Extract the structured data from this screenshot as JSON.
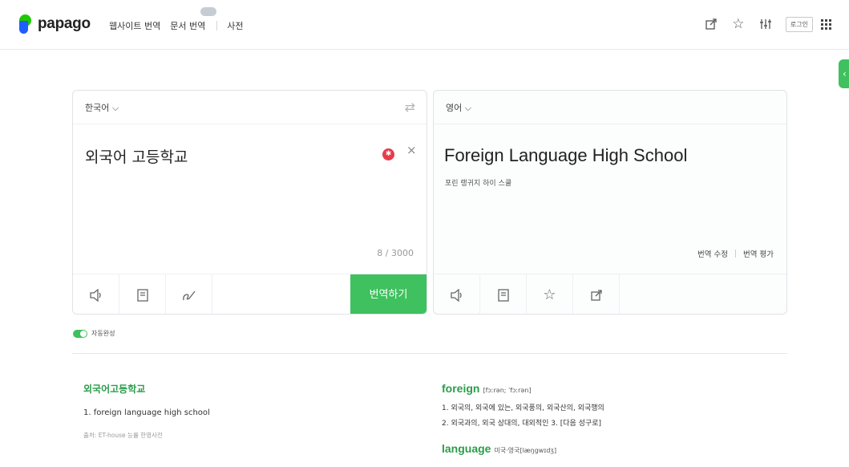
{
  "header": {
    "logo_text": "papago",
    "nav": {
      "website_translate": "웹사이트 번역",
      "document_translate": "문서 번역",
      "dictionary": "사전"
    },
    "login_label": "로그인"
  },
  "source": {
    "language": "한국어",
    "text": "외국어 고등학교",
    "char_count": "8 / 3000",
    "translate_button": "번역하기"
  },
  "target": {
    "language": "영어",
    "text": "Foreign Language High School",
    "pronunciation": "포린 랭귀지 하이 스쿨",
    "edit_label": "번역 수정",
    "rate_label": "번역 평가"
  },
  "auto_complete_label": "자동완성",
  "dictionary": {
    "left": {
      "word": "외국어고등학교",
      "meaning": "1. foreign language high school",
      "source": "출처: ET-house 능률 한영사전"
    },
    "right": {
      "entries": [
        {
          "word": "foreign",
          "phonetic": "[fɔːrən; ˈfɔːrən]",
          "lines": [
            "1. 외국의, 외국에 있는, 외국풍의, 외국산의, 외국행의",
            "2. 외국과의, 외국 상대의, 대외적인  3. [다음 성구로]"
          ]
        },
        {
          "word": "language",
          "phonetic": "미국·영국[læŋgwɪdʒ]"
        }
      ]
    }
  },
  "colors": {
    "accent_green": "#3ec15e",
    "dict_green": "#2a9d4a"
  },
  "icons": [
    "share-icon",
    "star-icon",
    "settings-icon",
    "apps-icon",
    "swap-icon",
    "clear-icon",
    "speaker-icon",
    "notebook-icon",
    "handwriting-icon",
    "export-icon"
  ]
}
